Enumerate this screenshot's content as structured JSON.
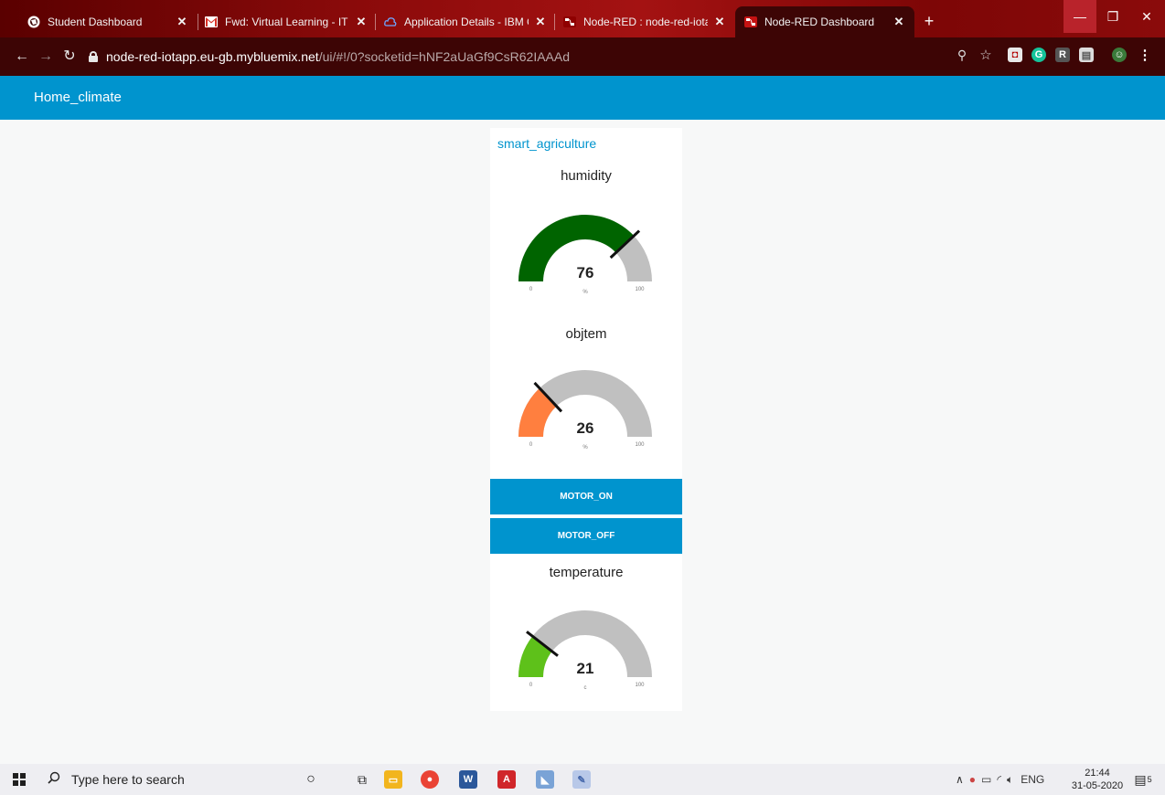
{
  "browser": {
    "tabs": [
      {
        "title": "Student Dashboard",
        "icon": "globe-icon",
        "active": false
      },
      {
        "title": "Fwd: Virtual Learning - IT Skill Co",
        "icon": "gmail-icon",
        "active": false
      },
      {
        "title": "Application Details - IBM Cloud",
        "icon": "ibm-cloud-icon",
        "active": false
      },
      {
        "title": "Node-RED : node-red-iotapp.eu",
        "icon": "node-red-icon",
        "active": false
      },
      {
        "title": "Node-RED Dashboard",
        "icon": "node-red-icon",
        "active": true
      }
    ],
    "url_host": "node-red-iotapp.eu-gb.mybluemix.net",
    "url_path": "/ui/#!/0?socketid=hNF2aUaGf9CsR62IAAAd"
  },
  "dashboard": {
    "header_title": "Home_climate",
    "group_title": "smart_agriculture",
    "gauges": [
      {
        "title": "humidity",
        "value": 76,
        "min": 0,
        "max": 100,
        "unit": "%",
        "color": "#006400"
      },
      {
        "title": "objtem",
        "value": 26,
        "min": 0,
        "max": 100,
        "unit": "%",
        "color": "#ff7f3f"
      },
      {
        "title": "temperature",
        "value": 21,
        "min": 0,
        "max": 100,
        "unit": "c",
        "color": "#5ec11a"
      }
    ],
    "buttons": {
      "motor_on": "MOTOR_ON",
      "motor_off": "MOTOR_OFF"
    },
    "accent_color": "#0094ce",
    "gauge_track_color": "#c0c0c0"
  },
  "taskbar": {
    "search_placeholder": "Type here to search",
    "language": "ENG",
    "time": "21:44",
    "date": "31-05-2020",
    "notification_count": "5"
  }
}
